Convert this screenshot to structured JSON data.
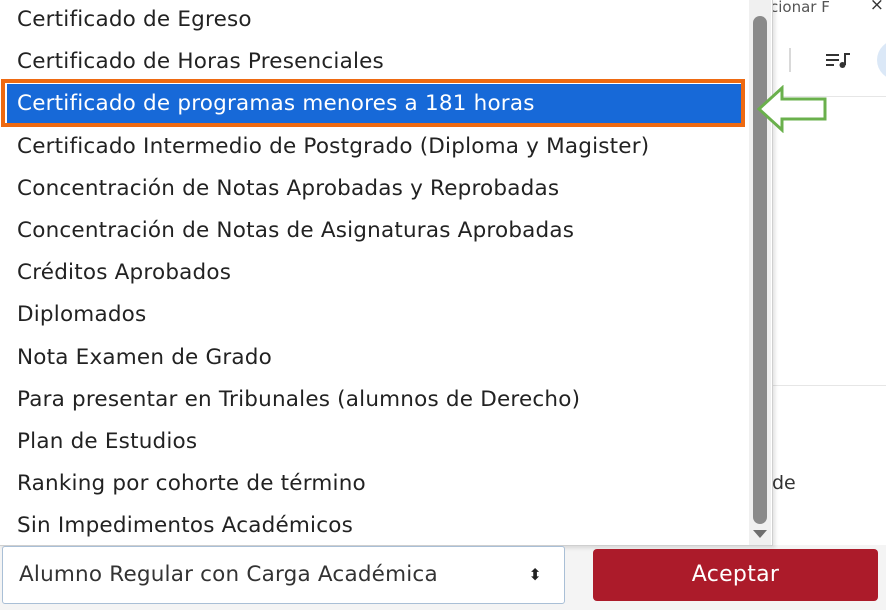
{
  "background": {
    "top_right_text": "cionar F",
    "close_glyph": "×",
    "partial_text": "de",
    "icons": [
      "list-music-icon",
      "avatar"
    ]
  },
  "dropdown": {
    "options": [
      {
        "label": "Certificado de Egreso",
        "selected": false
      },
      {
        "label": "Certificado de Horas Presenciales",
        "selected": false
      },
      {
        "label": "Certificado de programas menores a 181 horas",
        "selected": true
      },
      {
        "label": "Certificado Intermedio de Postgrado (Diploma y Magister)",
        "selected": false
      },
      {
        "label": "Concentración de Notas Aprobadas y Reprobadas",
        "selected": false
      },
      {
        "label": "Concentración de Notas de Asignaturas Aprobadas",
        "selected": false
      },
      {
        "label": "Créditos Aprobados",
        "selected": false
      },
      {
        "label": "Diplomados",
        "selected": false
      },
      {
        "label": "Nota Examen de Grado",
        "selected": false
      },
      {
        "label": "Para presentar en Tribunales (alumnos de Derecho)",
        "selected": false
      },
      {
        "label": "Plan de Estudios",
        "selected": false
      },
      {
        "label": "Ranking por cohorte de término",
        "selected": false
      },
      {
        "label": "Sin Impedimentos Académicos",
        "selected": false
      }
    ]
  },
  "select": {
    "value": "Alumno Regular con Carga Académica",
    "caret": "⬍"
  },
  "accept_button": {
    "label": "Aceptar"
  },
  "colors": {
    "selected_bg": "#1769d8",
    "highlight_outline": "#ee6a12",
    "arrow_annotation": "#6ab04c",
    "accept_bg": "#ac1b2a"
  }
}
